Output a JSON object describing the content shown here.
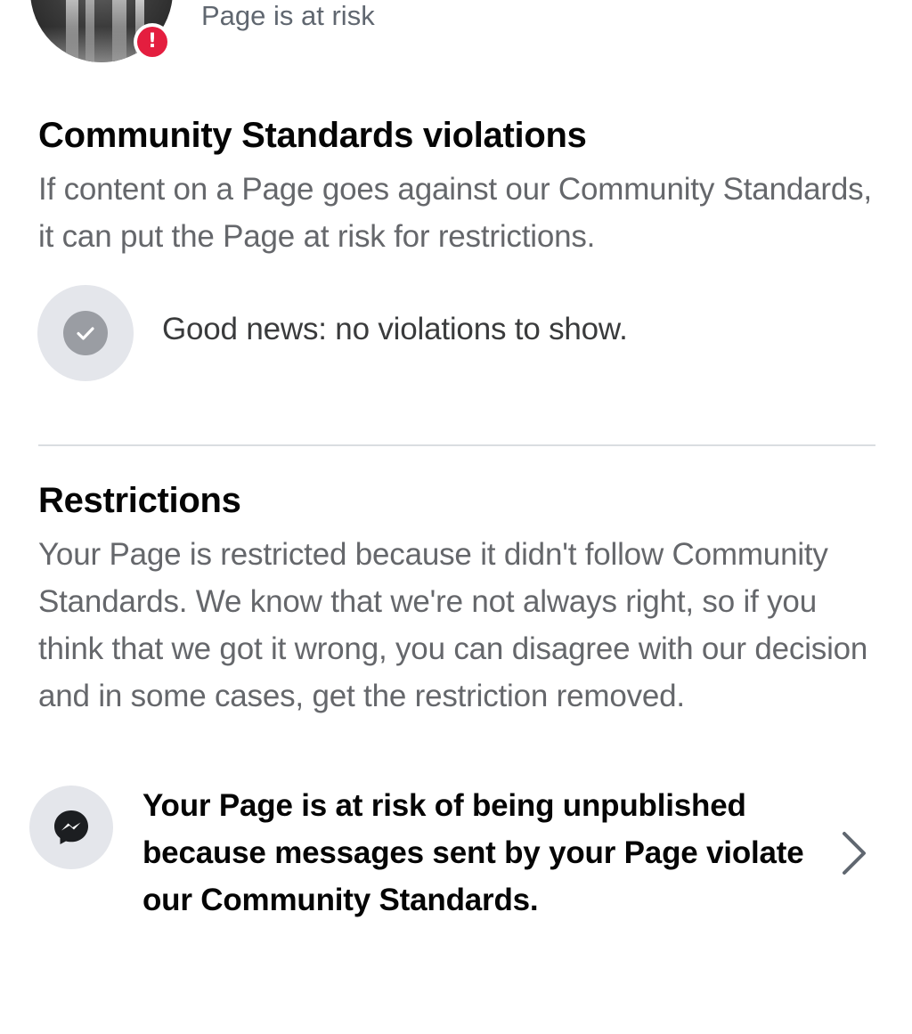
{
  "header": {
    "status_text": "Page is at risk",
    "badge_glyph": "!",
    "avatar_icon": "page-avatar",
    "badge_color": "#e41e3f"
  },
  "violations": {
    "title": "Community Standards violations",
    "description": "If content on a Page goes against our Community Standards, it can put the Page at risk for restrictions.",
    "empty_state_icon": "check-circle-icon",
    "empty_state_text": "Good news: no violations to show."
  },
  "restrictions": {
    "title": "Restrictions",
    "description": "Your Page is restricted because it didn't follow Community Standards. We know that we're not always right, so if you think that we got it wrong, you can disagree with our decision and in some cases, get the restriction removed.",
    "items": [
      {
        "icon": "messenger-icon",
        "text": "Your Page is at risk of being unpublished because messages sent by your Page violate our Community Standards.",
        "action_icon": "chevron-right-icon"
      }
    ]
  },
  "colors": {
    "primary_text": "#050505",
    "secondary_text": "#65676b",
    "icon_bg": "#e4e6eb",
    "divider": "#dadde1"
  }
}
